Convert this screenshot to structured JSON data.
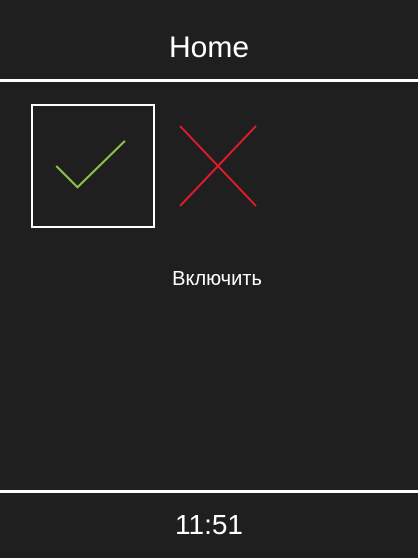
{
  "header": {
    "title": "Home"
  },
  "actions": {
    "confirm_icon": "check-icon",
    "cancel_icon": "x-icon",
    "confirm_color": "#8bc34a",
    "cancel_color": "#e21b2b"
  },
  "main": {
    "label": "Включить"
  },
  "footer": {
    "time": "11:51"
  }
}
